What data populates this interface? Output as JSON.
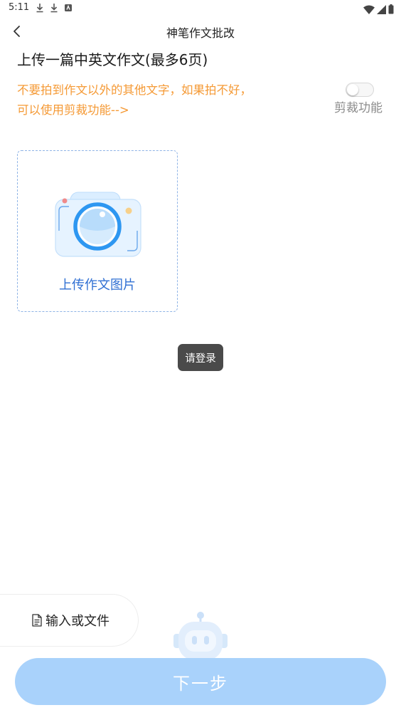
{
  "status_bar": {
    "time": "5:11",
    "left_icons": [
      "download-icon",
      "download-icon",
      "notification-app-icon"
    ],
    "right_icons": [
      "wifi-icon",
      "signal-icon",
      "battery-icon"
    ]
  },
  "app_bar": {
    "title": "神笔作文批改",
    "back_icon": "chevron-left-icon"
  },
  "main": {
    "heading": "上传一篇中英文作文(最多6页)",
    "tip_line1": "不要拍到作文以外的其他文字，如果拍不好，",
    "tip_line2": "可以使用剪裁功能-->",
    "crop_toggle": {
      "label": "剪裁功能",
      "on": false
    },
    "upload": {
      "label": "上传作文图片",
      "icon": "camera-icon"
    }
  },
  "toast": "请登录",
  "bottom": {
    "input_file_label": "输入或文件",
    "input_file_icon": "document-icon",
    "next_label": "下一步",
    "assistant_icon": "robot-icon"
  },
  "colors": {
    "tip": "#f59a36",
    "accent": "#2f6fd3",
    "next_button": "#a9d2fb",
    "toast_bg": "#4a4a4a"
  }
}
